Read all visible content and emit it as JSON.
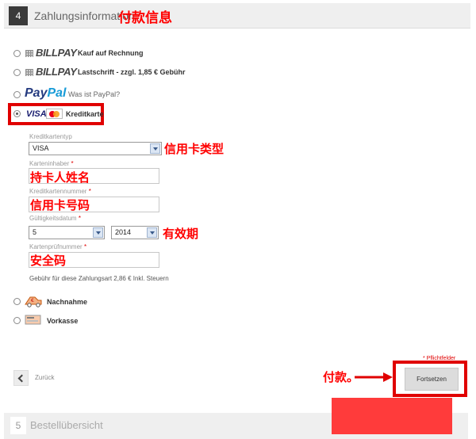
{
  "section4": {
    "number": "4",
    "title": "Zahlungsinformation",
    "annotation": "付款信息"
  },
  "options": {
    "billpay_rechnung": {
      "logo": "BILLPAY",
      "desc": "Kauf auf Rechnung"
    },
    "billpay_lastschrift": {
      "logo": "BILLPAY",
      "desc": "Lastschrift - zzgl. 1,85 € Gebühr"
    },
    "paypal": {
      "logo_a": "Pay",
      "logo_b": "Pal",
      "desc": "Was ist PayPal?"
    },
    "kreditkarte": {
      "logo": "VISA",
      "desc": "Kreditkarte"
    },
    "nachnahme": {
      "desc": "Nachnahme"
    },
    "vorkasse": {
      "desc": "Vorkasse"
    }
  },
  "form": {
    "card_type_label": "Kreditkartentyp",
    "card_type_value": "VISA",
    "card_type_anno": "信用卡类型",
    "holder_label": "Karteninhaber",
    "holder_anno": "持卡人姓名",
    "number_label": "Kreditkartennummer",
    "number_anno": "信用卡号码",
    "expiry_label": "Gültigkeitsdatum",
    "expiry_month": "5",
    "expiry_year": "2014",
    "expiry_anno": "有效期",
    "cvc_label": "Kartenprüfnummer",
    "cvc_anno": "安全码",
    "required_mark": "*",
    "fee_note": "Gebühr für diese Zahlungsart 2,86 € Inkl. Steuern"
  },
  "footer": {
    "required_note": "* Pflichtfelder",
    "back_label": "Zurück",
    "continue_label": "Fortsetzen",
    "pay_anno": "付款。"
  },
  "section5": {
    "number": "5",
    "title": "Bestellübersicht"
  },
  "colors": {
    "annotation": "#ff0000",
    "header_bg": "#efefef",
    "redbox": "#ff3b3b"
  }
}
